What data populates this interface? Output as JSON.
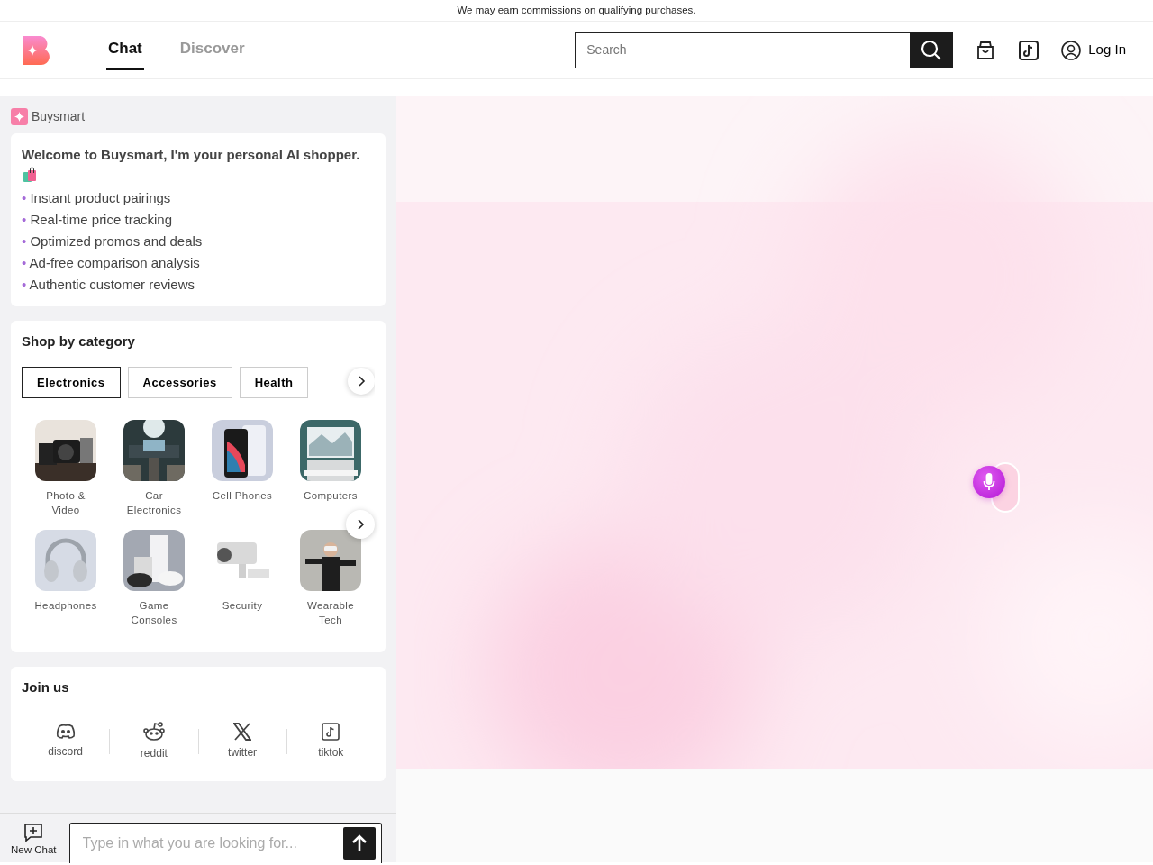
{
  "notice": "We may earn commissions on qualifying purchases.",
  "nav": {
    "tabs": [
      {
        "label": "Chat",
        "selected": true
      },
      {
        "label": "Discover",
        "selected": false
      }
    ],
    "search": {
      "placeholder": "Search"
    },
    "login": "Log In"
  },
  "brand": "Buysmart",
  "welcome": {
    "title": "Welcome to Buysmart, I'm your personal AI shopper.",
    "bullet": "•",
    "bullets": [
      "Instant product pairings",
      "Real-time price tracking",
      "Optimized promos and deals",
      "Ad-free comparison analysis",
      "Authentic customer reviews"
    ]
  },
  "shop": {
    "title": "Shop by category",
    "tabs": [
      {
        "label": "Electronics",
        "selected": true
      },
      {
        "label": "Accessories",
        "selected": false
      },
      {
        "label": "Health",
        "selected": false
      }
    ],
    "items": [
      {
        "label": "Photo & Video",
        "kind": "camera"
      },
      {
        "label": "Car Electronics",
        "kind": "car"
      },
      {
        "label": "Cell Phones",
        "kind": "phone"
      },
      {
        "label": "Computers",
        "kind": "computer"
      },
      {
        "label": "Headphones",
        "kind": "headphones"
      },
      {
        "label": "Game Consoles",
        "kind": "console"
      },
      {
        "label": "Security",
        "kind": "security"
      },
      {
        "label": "Wearable Tech",
        "kind": "wearable"
      }
    ]
  },
  "join": {
    "title": "Join us",
    "links": [
      {
        "label": "discord",
        "kind": "discord"
      },
      {
        "label": "reddit",
        "kind": "reddit"
      },
      {
        "label": "twitter",
        "kind": "twitter"
      },
      {
        "label": "tiktok",
        "kind": "tiktok"
      }
    ]
  },
  "composer": {
    "new_chat": "New Chat",
    "placeholder": "Type in what you are looking for..."
  }
}
